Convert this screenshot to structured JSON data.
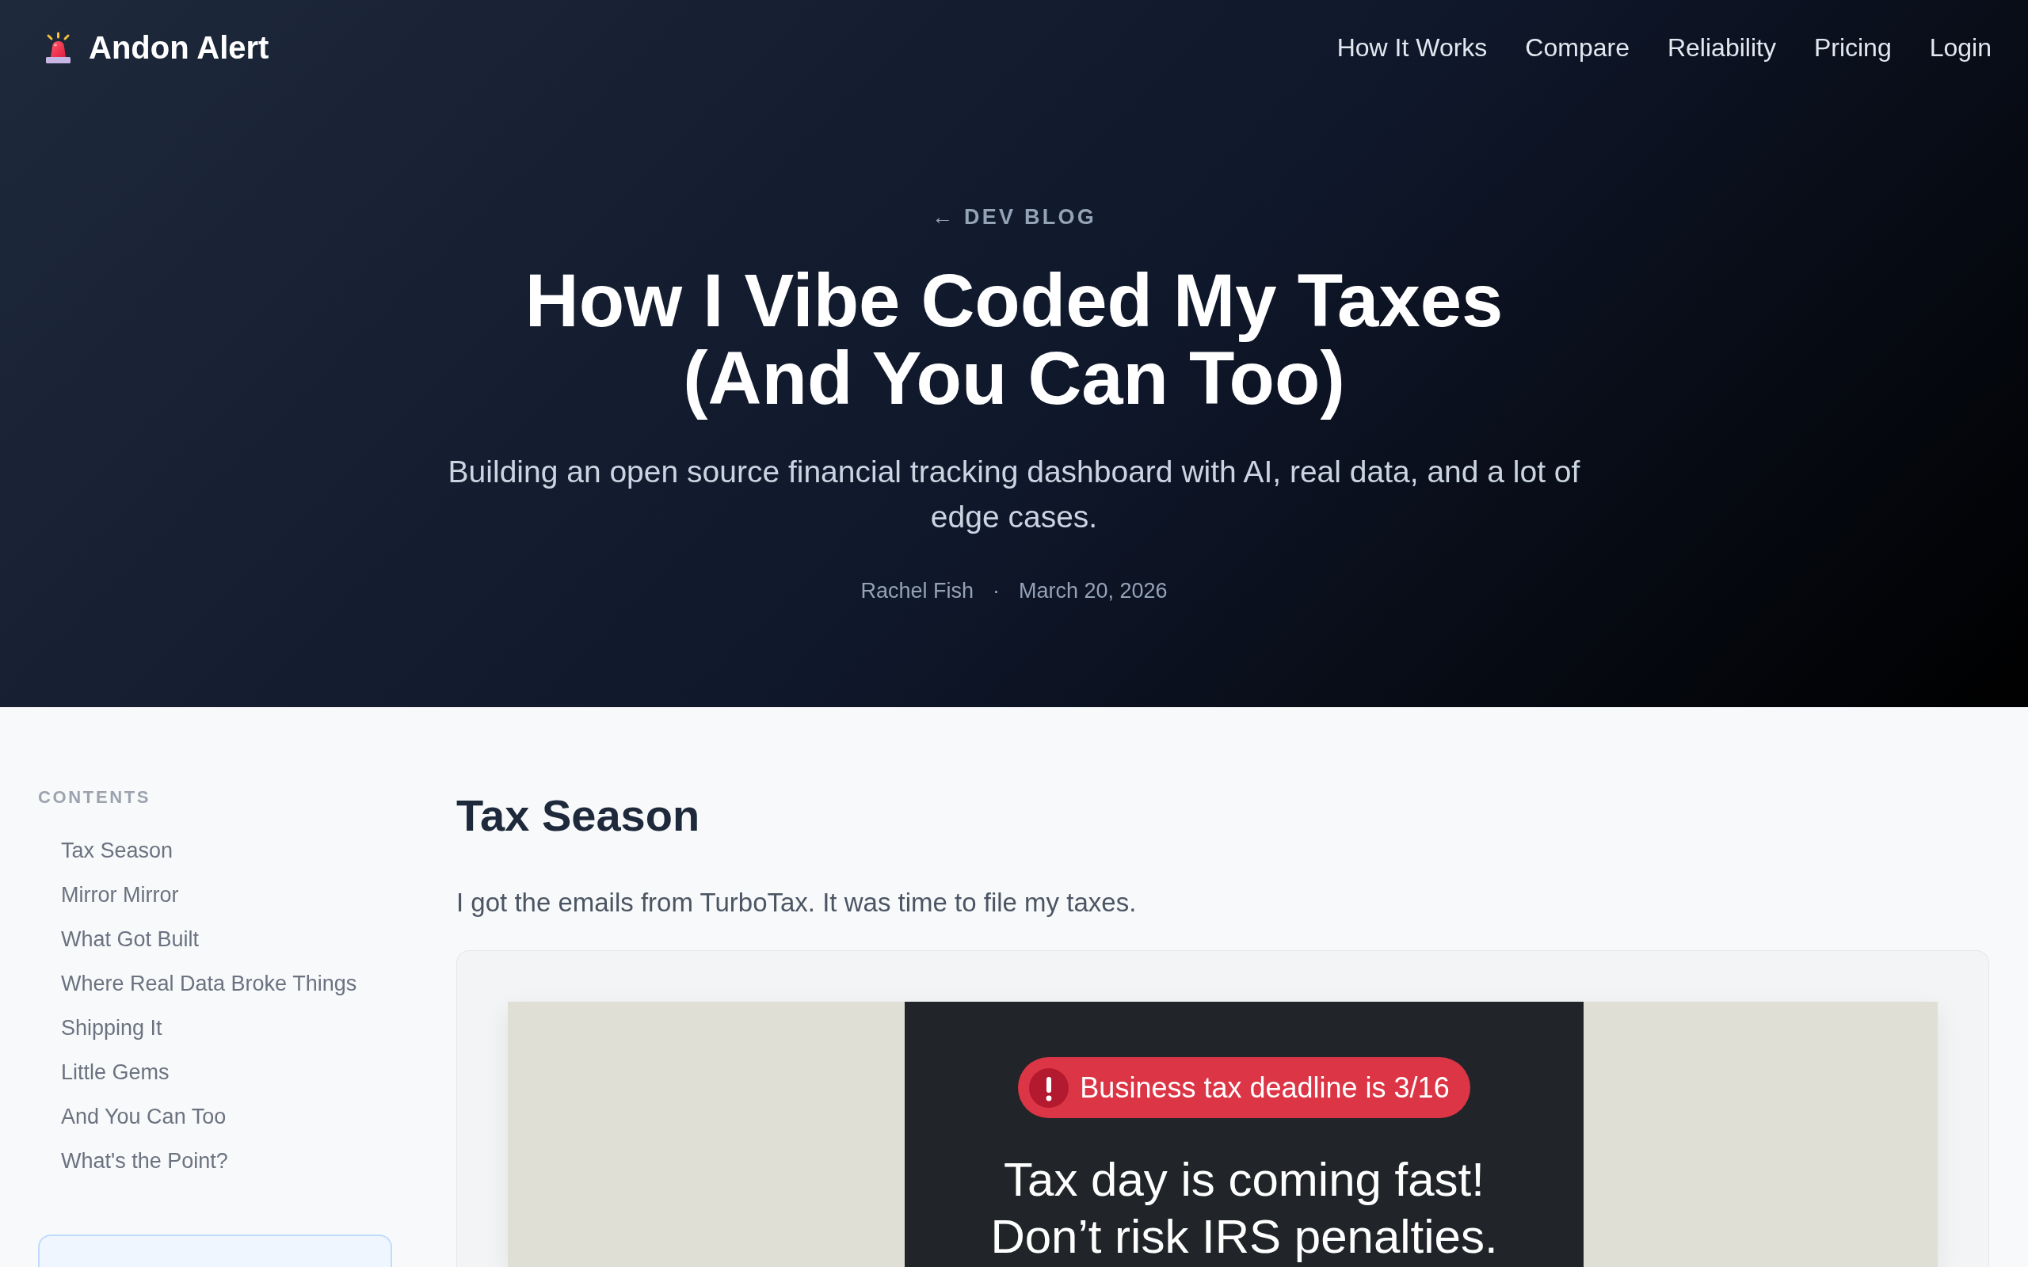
{
  "navbar": {
    "brand": "Andon Alert",
    "links": [
      "How It Works",
      "Compare",
      "Reliability",
      "Pricing",
      "Login"
    ]
  },
  "hero": {
    "back_link": "← DEV BLOG",
    "title": "How I Vibe Coded My Taxes (And You Can Too)",
    "subtitle": "Building an open source financial tracking dashboard with AI, real data, and a lot of edge cases.",
    "author": "Rachel Fish",
    "separator": "·",
    "date": "March 20, 2026"
  },
  "sidebar": {
    "heading": "CONTENTS",
    "items": [
      "Tax Season",
      "Mirror Mirror",
      "What Got Built",
      "Where Real Data Broke Things",
      "Shipping It",
      "Little Gems",
      "And You Can Too",
      "What's the Point?"
    ]
  },
  "article": {
    "heading": "Tax Season",
    "paragraph": "I got the emails from TurboTax. It was time to file my taxes.",
    "figure": {
      "badge": "Business tax deadline is 3/16",
      "headline": [
        "Tax day is coming fast!",
        "Don’t risk IRS penalties."
      ]
    }
  }
}
